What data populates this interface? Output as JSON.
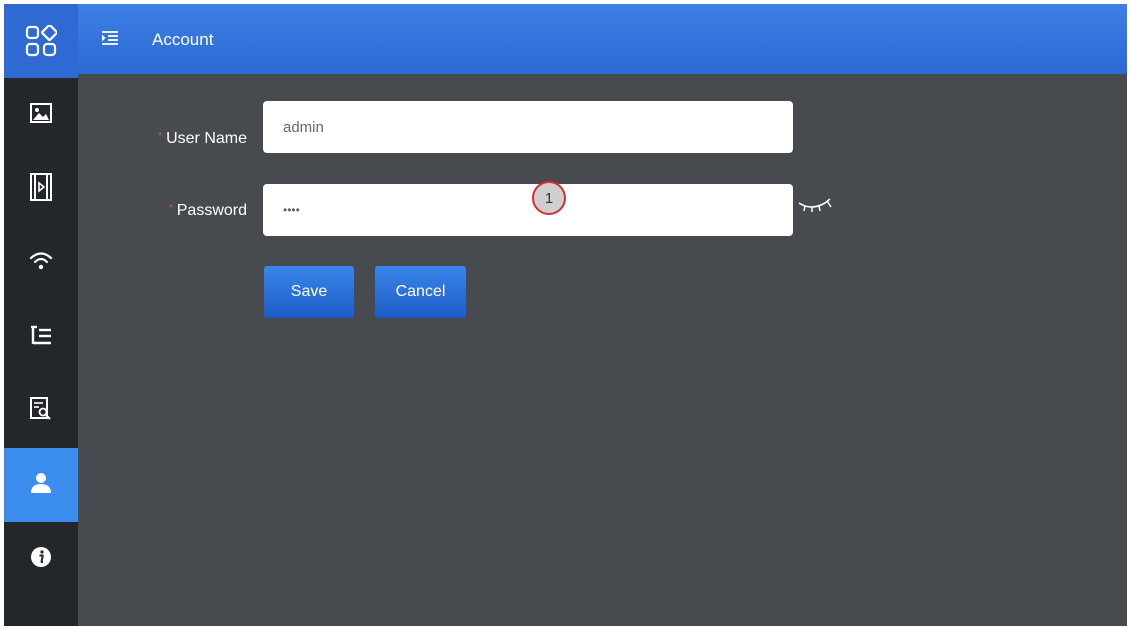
{
  "header": {
    "title": "Account",
    "menu_toggle_icon": "menu-indent-icon"
  },
  "sidebar": {
    "logo_icon": "apps-grid-icon",
    "items": [
      {
        "icon": "image-icon"
      },
      {
        "icon": "video-icon"
      },
      {
        "icon": "wifi-icon"
      },
      {
        "icon": "list-tree-icon"
      },
      {
        "icon": "search-document-icon"
      },
      {
        "icon": "user-icon",
        "active": true
      },
      {
        "icon": "info-icon"
      }
    ]
  },
  "form": {
    "required_mark": "*",
    "username_label": "User Name",
    "username_value": "admin",
    "password_label": "Password",
    "password_value": "••••",
    "password_toggle_icon": "eye-closed-icon",
    "save_label": "Save",
    "cancel_label": "Cancel"
  },
  "annotation": {
    "callout_number": "1"
  },
  "colors": {
    "header": "#2c69d3",
    "sidebar": "#23272c",
    "sidebar_active": "#3a8ded",
    "content_bg": "#474b4f",
    "button": "#2a6ed9",
    "required": "#e05555",
    "callout_border": "#d32f2f"
  }
}
